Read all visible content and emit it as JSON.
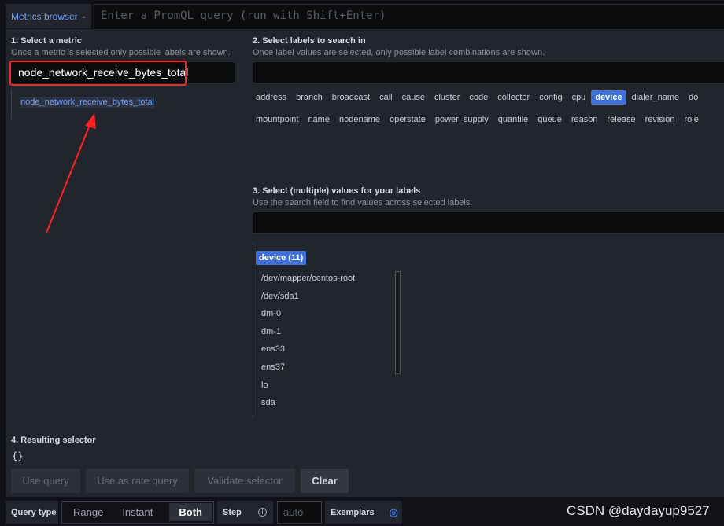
{
  "toolbar": {
    "metrics_browser_label": "Metrics browser",
    "query_placeholder": "Enter a PromQL query (run with Shift+Enter)"
  },
  "step1": {
    "title": "1. Select a metric",
    "subtitle": "Once a metric is selected only possible labels are shown.",
    "search_value": "node_network_receive_bytes_total",
    "results": [
      "node_network_receive_bytes_total"
    ]
  },
  "step2": {
    "title": "2. Select labels to search in",
    "subtitle": "Once label values are selected, only possible label combinations are shown.",
    "search_value": "",
    "labels_row1": [
      "address",
      "branch",
      "broadcast",
      "call",
      "cause",
      "cluster",
      "code",
      "collector",
      "config",
      "cpu",
      "device",
      "dialer_name",
      "do"
    ],
    "labels_row2": [
      "mountpoint",
      "name",
      "nodename",
      "operstate",
      "power_supply",
      "quantile",
      "queue",
      "reason",
      "release",
      "revision",
      "role"
    ],
    "selected": "device"
  },
  "step3": {
    "title": "3. Select (multiple) values for your labels",
    "subtitle": "Use the search field to find values across selected labels.",
    "search_value": "",
    "group_label": "device (11)",
    "values": [
      "/dev/mapper/centos-root",
      "/dev/sda1",
      "dm-0",
      "dm-1",
      "ens33",
      "ens37",
      "lo",
      "sda"
    ]
  },
  "step4": {
    "title": "4. Resulting selector",
    "selector": "{}"
  },
  "buttons": {
    "use_query": "Use query",
    "use_rate": "Use as rate query",
    "validate": "Validate selector",
    "clear": "Clear"
  },
  "options": {
    "query_type_label": "Query type",
    "query_types": [
      "Range",
      "Instant",
      "Both"
    ],
    "selected_query_type": "Both",
    "step_label": "Step",
    "step_placeholder": "auto",
    "exemplars_label": "Exemplars"
  },
  "watermark": "CSDN @daydayup9527",
  "colors": {
    "accent": "#3d71d9",
    "link": "#6e9fff",
    "annotation": "#ff2222"
  }
}
